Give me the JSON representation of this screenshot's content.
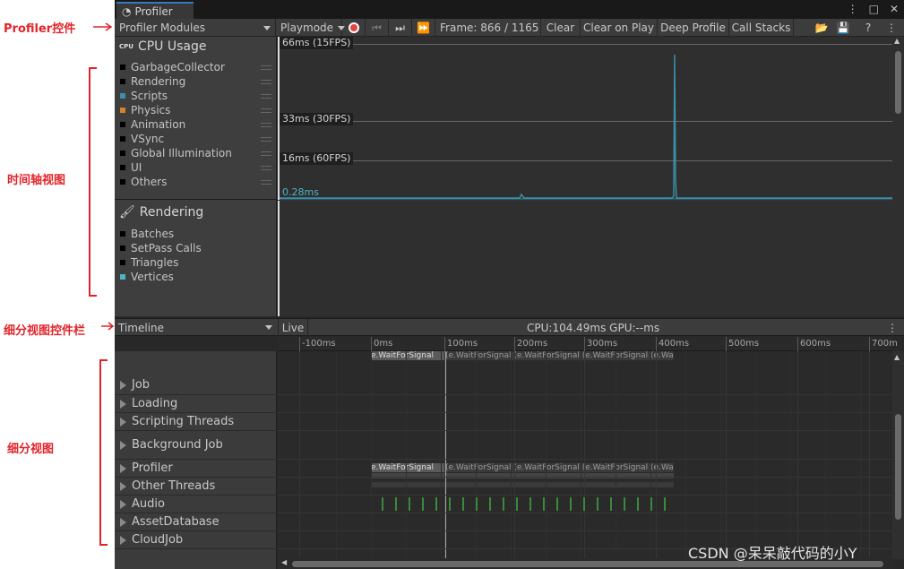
{
  "annotations": {
    "profiler_controls": "Profiler控件",
    "timeline_view": "时间轴视图",
    "detail_toolbar": "细分视图控件栏",
    "detail_view": "细分视图"
  },
  "window": {
    "tab_title": "Profiler",
    "tab_icons": [
      "more-vertical-icon",
      "maximize-icon",
      "close-icon"
    ]
  },
  "toolbar": {
    "modules": "Profiler Modules",
    "playmode": "Playmode",
    "frame": "Frame: 866 / 1165",
    "clear": "Clear",
    "clear_on_play": "Clear on Play",
    "deep_profile": "Deep Profile",
    "call_stacks": "Call Stacks"
  },
  "cpu_module": {
    "title": "CPU Usage",
    "icon_text": "CPU",
    "items": [
      {
        "label": "GarbageCollector",
        "color": "#000000"
      },
      {
        "label": "Rendering",
        "color": "#000000"
      },
      {
        "label": "Scripts",
        "color": "#3b8fa8"
      },
      {
        "label": "Physics",
        "color": "#d7822a"
      },
      {
        "label": "Animation",
        "color": "#000000"
      },
      {
        "label": "VSync",
        "color": "#000000"
      },
      {
        "label": "Global Illumination",
        "color": "#000000"
      },
      {
        "label": "UI",
        "color": "#000000"
      },
      {
        "label": "Others",
        "color": "#000000"
      }
    ],
    "chart_labels": {
      "fps15": "66ms (15FPS)",
      "fps30": "33ms (30FPS)",
      "fps60": "16ms (60FPS)",
      "current": "0.28ms"
    }
  },
  "rendering_module": {
    "title": "Rendering",
    "items": [
      {
        "label": "Batches",
        "color": "#000000"
      },
      {
        "label": "SetPass Calls",
        "color": "#000000"
      },
      {
        "label": "Triangles",
        "color": "#000000"
      },
      {
        "label": "Vertices",
        "color": "#4fb3c8"
      }
    ]
  },
  "detail_bar": {
    "view_select": "Timeline",
    "live": "Live",
    "stats": "CPU:104.49ms   GPU:--ms"
  },
  "ruler": [
    "-100ms",
    "0ms",
    "100ms",
    "200ms",
    "300ms",
    "400ms",
    "500ms",
    "600ms",
    "700m"
  ],
  "thread_groups": [
    "Job",
    "Loading",
    "Scripting Threads",
    "Background Job",
    "Profiler",
    "Other Threads",
    "Audio",
    "AssetDatabase",
    "CloudJob"
  ],
  "samples": {
    "wait": "e.WaitForSignal",
    "wait2": "(e.WaitForSignal (e.WaitForSignal (e.WaitForSignal (e.WaitForSignal ("
  },
  "watermark": "CSDN @呆呆敲代码的小Y"
}
